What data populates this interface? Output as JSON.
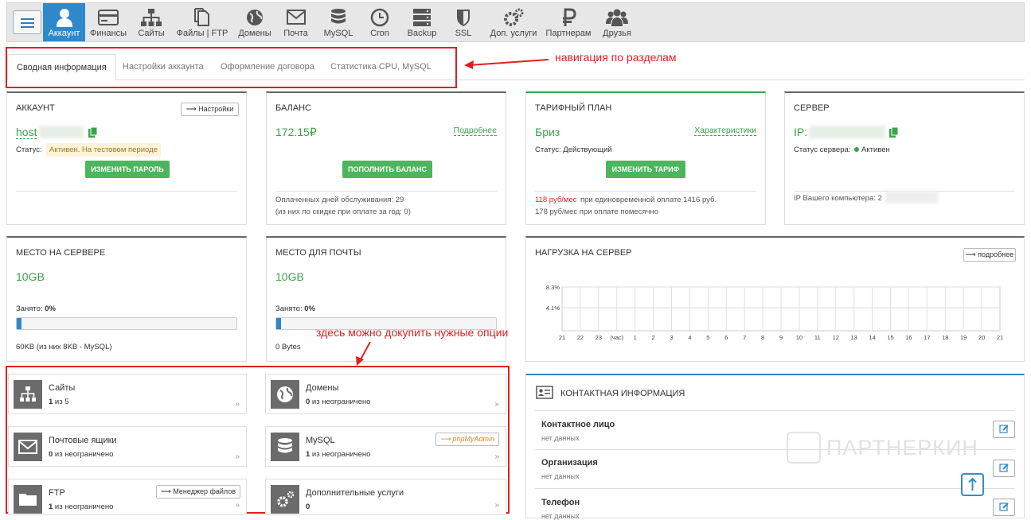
{
  "nav": {
    "items": [
      {
        "label": "Аккаунт",
        "icon": "user-icon"
      },
      {
        "label": "Финансы",
        "icon": "credit-card-icon"
      },
      {
        "label": "Сайты",
        "icon": "sitemap-icon"
      },
      {
        "label": "Файлы | FTP",
        "icon": "files-icon"
      },
      {
        "label": "Домены",
        "icon": "globe-icon"
      },
      {
        "label": "Почта",
        "icon": "envelope-icon"
      },
      {
        "label": "MySQL",
        "icon": "database-icon"
      },
      {
        "label": "Cron",
        "icon": "clock-icon"
      },
      {
        "label": "Backup",
        "icon": "server-icon"
      },
      {
        "label": "SSL",
        "icon": "shield-icon"
      },
      {
        "label": "Доп. услуги",
        "icon": "gears-icon"
      },
      {
        "label": "Партнерам",
        "icon": "ruble-icon"
      },
      {
        "label": "Друзья",
        "icon": "users-icon"
      }
    ]
  },
  "tabs": [
    "Сводная информация",
    "Настройки аккаунта",
    "Оформление договора",
    "Статистика CPU, MySQL"
  ],
  "annotations": {
    "nav_hint": "навигация по разделам",
    "options_hint": "здесь можно докупить нужные опции"
  },
  "account": {
    "title": "АККАУНТ",
    "settings_button": "⟶ Настройки",
    "login": "host",
    "status_label": "Статус:",
    "status_value": "Активен. На тестовом периоде",
    "change_password": "ИЗМЕНИТЬ ПАРОЛЬ"
  },
  "balance": {
    "title": "БАЛАНС",
    "amount": "172.15₽",
    "details_link": "Подробнее",
    "topup_button": "ПОПОЛНИТЬ БАЛАНС",
    "paid_days": "Оплаченных дней обслуживания: 29",
    "discount_note": "(из них по скидке при оплате за год: 0)"
  },
  "plan": {
    "title": "ТАРИФНЫЙ ПЛАН",
    "name": "Бриз",
    "specs_link": "Характеристики",
    "status": "Статус: Действующий",
    "change_button": "ИЗМЕНИТЬ ТАРИФ",
    "price_yearly_red": "118 руб/мес",
    "price_yearly_rest": " при единовременной оплате 1416 руб.",
    "price_monthly": "178 руб/мес при оплате помесячно"
  },
  "server": {
    "title": "СЕРВЕР",
    "ip_label": "IP:",
    "status_label": "Статус сервера:",
    "status_value": "Активен",
    "your_ip_label": "IP Вашего компьютера: 2"
  },
  "disk": {
    "title": "МЕСТО НА СЕРВЕРЕ",
    "size": "10GB",
    "used_label": "Занято:",
    "used_value": "0%",
    "used_fraction": 0.0,
    "detail": "60KB (из них 8KB - MySQL)"
  },
  "mail_space": {
    "title": "МЕСТО ДЛЯ ПОЧТЫ",
    "size": "10GB",
    "used_label": "Занято:",
    "used_value": "0%",
    "used_fraction": 0.0,
    "detail": "0 Bytes"
  },
  "load": {
    "title": "НАГРУЗКА НА СЕРВЕР",
    "details_button": "⟶ подробнее",
    "y_labels": [
      "8.3%",
      "4.1%"
    ],
    "x_labels": [
      "21",
      "22",
      "23",
      "(час)",
      "1",
      "2",
      "3",
      "4",
      "5",
      "6",
      "7",
      "8",
      "9",
      "10",
      "11",
      "12",
      "13",
      "14",
      "15",
      "16",
      "17",
      "18",
      "19",
      "20",
      "21"
    ]
  },
  "services": [
    {
      "name": "Сайты",
      "count_bold": "1",
      "count_rest": " из 5",
      "icon": "sitemap-icon"
    },
    {
      "name": "Домены",
      "count_bold": "0",
      "count_rest": " из неограничено",
      "icon": "globe-icon"
    },
    {
      "name": "Почтовые ящики",
      "count_bold": "0",
      "count_rest": " из неограничено",
      "icon": "envelope-icon"
    },
    {
      "name": "MySQL",
      "count_bold": "1",
      "count_rest": " из неограничено",
      "icon": "database-icon",
      "button": "⟶ phpMyAdmin"
    },
    {
      "name": "FTP",
      "count_bold": "1",
      "count_rest": " из неограничено",
      "icon": "folder-icon",
      "button": "⟶ Менеджер файлов"
    },
    {
      "name": "Дополнительные услуги",
      "count_bold": "0",
      "count_rest": "",
      "icon": "gears-icon"
    }
  ],
  "contacts": {
    "title": "КОНТАКТНАЯ ИНФОРМАЦИЯ",
    "rows": [
      {
        "label": "Контактное лицо",
        "value": "нет данных"
      },
      {
        "label": "Организация",
        "value": "нет данных"
      },
      {
        "label": "Телефон",
        "value": "нет данных"
      }
    ]
  },
  "watermark": "ПАРТНЕРКИН",
  "colors": {
    "accent": "#2f88c9",
    "green": "#3aa34a",
    "annotation": "#e02020"
  }
}
